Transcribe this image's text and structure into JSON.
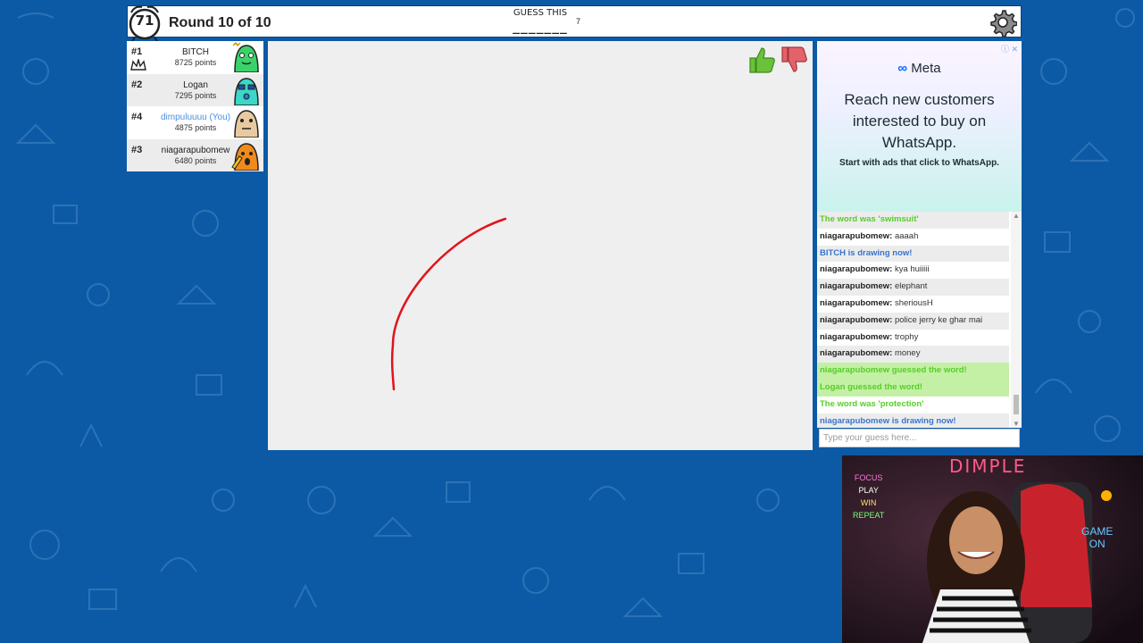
{
  "timer": "71",
  "round_text": "Round 10 of 10",
  "word": {
    "label": "GUESS THIS",
    "blanks": "_______",
    "length": "7"
  },
  "players": [
    {
      "rank": "#1",
      "name": "BITCH",
      "points": "8725 points",
      "you": false,
      "avatar_color": "#3ad36a",
      "crown": true
    },
    {
      "rank": "#2",
      "name": "Logan",
      "points": "7295 points",
      "you": false,
      "avatar_color": "#3bd7c8",
      "crown": false
    },
    {
      "rank": "#4",
      "name": "dimpuluuuu (You)",
      "points": "4875 points",
      "you": true,
      "avatar_color": "#e8c9a0",
      "crown": false
    },
    {
      "rank": "#3",
      "name": "niagarapubomew",
      "points": "6480 points",
      "you": false,
      "avatar_color": "#f08a1a",
      "crown": false
    }
  ],
  "ad": {
    "brand": "Meta",
    "headline": "Reach new customers interested to buy on WhatsApp.",
    "subline": "Start with ads that click to WhatsApp."
  },
  "chat": [
    {
      "kind": "sys-green",
      "text": "The word was 'swimsuit'",
      "bg": "a"
    },
    {
      "kind": "msg",
      "author": "niagarapubomew:",
      "text": "aaaah",
      "bg": "b"
    },
    {
      "kind": "sys-blue",
      "text": "BITCH is drawing now!",
      "bg": "a"
    },
    {
      "kind": "msg",
      "author": "niagarapubomew:",
      "text": "kya huiiiii",
      "bg": "b"
    },
    {
      "kind": "msg",
      "author": "niagarapubomew:",
      "text": "elephant",
      "bg": "a"
    },
    {
      "kind": "msg",
      "author": "niagarapubomew:",
      "text": "sheriousH",
      "bg": "b"
    },
    {
      "kind": "msg",
      "author": "niagarapubomew:",
      "text": "police jerry ke ghar mai",
      "bg": "a"
    },
    {
      "kind": "msg",
      "author": "niagarapubomew:",
      "text": "trophy",
      "bg": "b"
    },
    {
      "kind": "msg",
      "author": "niagarapubomew:",
      "text": "money",
      "bg": "a"
    },
    {
      "kind": "sys-green",
      "text": "niagarapubomew guessed the word!",
      "bg": "g"
    },
    {
      "kind": "sys-green",
      "text": "Logan guessed the word!",
      "bg": "g"
    },
    {
      "kind": "sys-green",
      "text": "The word was 'protection'",
      "bg": "b"
    },
    {
      "kind": "sys-blue",
      "text": "niagarapubomew is drawing now!",
      "bg": "a"
    }
  ],
  "guess_input": {
    "placeholder": "Type your guess here...",
    "value": ""
  },
  "webcam_overlay": {
    "sign_top": "DIMPLE",
    "neon_left": [
      "FOCUS",
      "PLAY",
      "WIN",
      "REPEAT"
    ],
    "neon_right": [
      "GAME",
      "ON"
    ]
  },
  "colors": {
    "background": "#0c5aa6",
    "stroke": "#e0141d",
    "accent_green": "#56ce27",
    "accent_blue": "#3975ce"
  }
}
